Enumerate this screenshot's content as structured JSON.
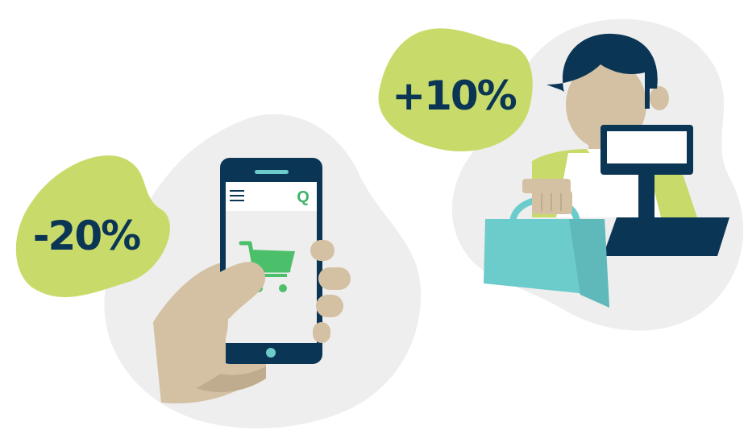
{
  "badges": {
    "online_discount": "-20%",
    "store_markup": "+10%"
  },
  "phone": {
    "app_logo": "Q",
    "menu_icon": "hamburger-menu-icon",
    "cart_icon": "shopping-cart-icon"
  },
  "colors": {
    "navy": "#0b3554",
    "lime": "#c8db6a",
    "green": "#4cbf6b",
    "teal": "#6ccbcb",
    "skin": "#d4c1a4",
    "blob_gray": "#eeeeee"
  }
}
